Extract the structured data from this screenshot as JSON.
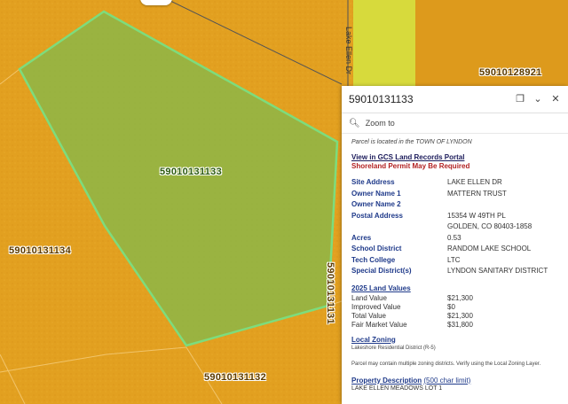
{
  "map": {
    "colors": {
      "parcel_fill": "#e2a020",
      "selected_fill": "#8fb545",
      "selected_outline": "#7ddc7d",
      "yellow_strip": "#d7da3c",
      "road": "#555555"
    },
    "parcel_labels": [
      {
        "id": "label-selected",
        "text": "59010131133"
      },
      {
        "id": "label-west",
        "text": "59010131134"
      },
      {
        "id": "label-south",
        "text": "59010131132"
      },
      {
        "id": "label-east",
        "text": "59010131131"
      },
      {
        "id": "label-northeast",
        "text": "59010128921"
      }
    ],
    "road_label": "Lake Ellen Dr",
    "top_button": "⌄"
  },
  "popup": {
    "title": "59010131133",
    "icons": {
      "dock": "dock-icon",
      "collapse": "chevron-down-icon",
      "close": "close-icon"
    },
    "zoom_to": "Zoom to",
    "location_note": "Parcel is located in the TOWN OF LYNDON",
    "gcs_link": "View in GCS Land Records Portal",
    "shoreland": "Shoreland Permit May Be Required",
    "attributes": [
      {
        "key": "Site Address",
        "value": "LAKE ELLEN DR"
      },
      {
        "key": "Owner Name 1",
        "value": "MATTERN TRUST"
      },
      {
        "key": "Owner Name 2",
        "value": ""
      },
      {
        "key": "Postal Address",
        "value": "15354 W 49TH PL"
      },
      {
        "key": "",
        "value": "GOLDEN, CO 80403-1858"
      },
      {
        "key": "Acres",
        "value": "0.53"
      },
      {
        "key": "School District",
        "value": "RANDOM LAKE SCHOOL"
      },
      {
        "key": "Tech College",
        "value": "LTC"
      },
      {
        "key": "Special District(s)",
        "value": "LYNDON SANITARY DISTRICT"
      }
    ],
    "land_values_head": "2025 Land Values",
    "land_values": [
      {
        "key": "Land Value",
        "value": "$21,300"
      },
      {
        "key": "Improved Value",
        "value": "$0"
      },
      {
        "key": "Total Value",
        "value": "$21,300"
      },
      {
        "key": "Fair Market Value",
        "value": "$31,800"
      }
    ],
    "zoning_head": "Local Zoning",
    "zoning_value": "Lakeshore Residential District (R-5)",
    "zoning_note": "Parcel may contain multiple zoning districts. Verify using the Local Zoning Layer.",
    "desc_head": "Property Description",
    "desc_limit": "(500 char limit)",
    "desc_value": "LAKE ELLEN MEADOWS LOT 1"
  }
}
